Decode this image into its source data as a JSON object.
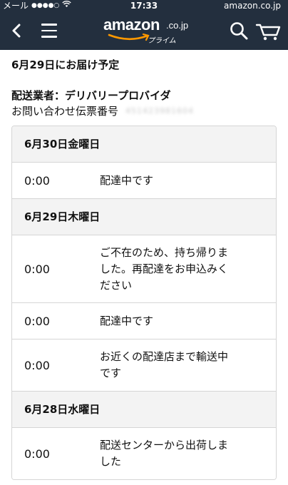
{
  "status_bar": {
    "carrier": "メール",
    "signal": "●●●●○",
    "time": "17:33",
    "url": "amazon.co.jp"
  },
  "header": {
    "logo_word": "amazon",
    "logo_tld": ".co.jp",
    "logo_sub": "プライム"
  },
  "delivery": {
    "expected": "6月29日にお届け予定",
    "carrier": "配送業者：デリバリープロバイダ",
    "tracking_label": "お問い合わせ伝票番号",
    "tracking_number": "451423981604"
  },
  "timeline": [
    {
      "date": "6月30日金曜日",
      "events": [
        {
          "time": "0:00",
          "status": "配達中です"
        }
      ]
    },
    {
      "date": "6月29日木曜日",
      "events": [
        {
          "time": "0:00",
          "status": "ご不在のため、持ち帰りました。再配達をお申込みください"
        },
        {
          "time": "0:00",
          "status": "配達中です"
        },
        {
          "time": "0:00",
          "status": "お近くの配達店まで輸送中です"
        }
      ]
    },
    {
      "date": "6月28日水曜日",
      "events": [
        {
          "time": "0:00",
          "status": "配送センターから出荷しました"
        }
      ]
    }
  ]
}
